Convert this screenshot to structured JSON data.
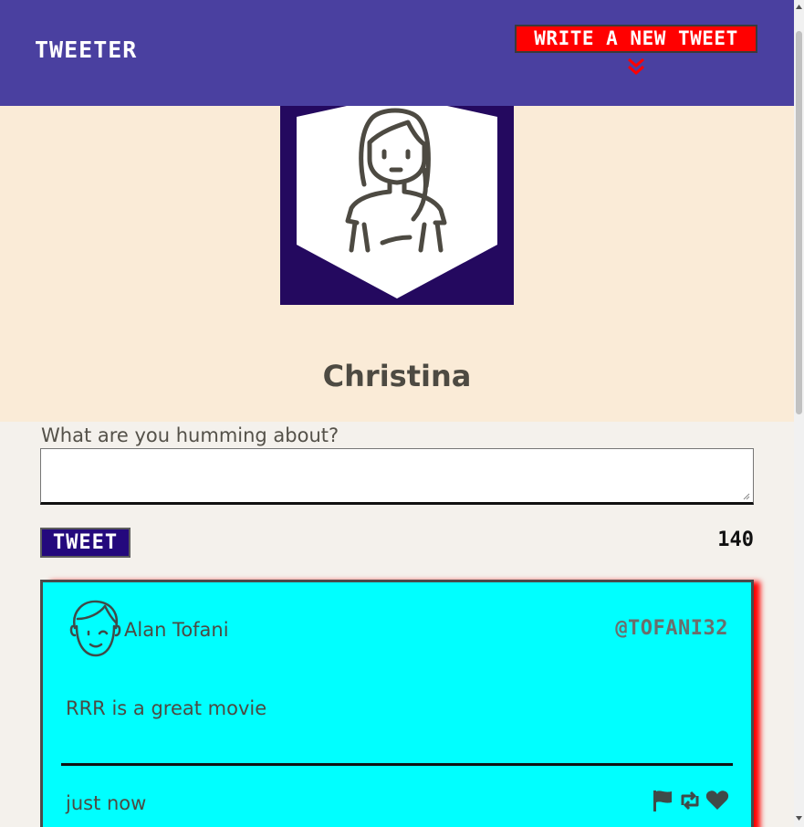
{
  "nav": {
    "brand": "TWEETER",
    "compose_label": "WRITE A NEW TWEET",
    "compose_icon": "double-chevron-down-icon"
  },
  "profile": {
    "name": "Christina",
    "avatar_icon": "woman-avatar-icon"
  },
  "composer": {
    "label": "What are you humming about?",
    "value": "",
    "button_label": "TWEET",
    "counter": "140"
  },
  "tweets": [
    {
      "name": "Alan Tofani",
      "handle": "@TOFANI32",
      "content": "RRR is a great movie",
      "time": "just now",
      "actions": [
        "flag-icon",
        "retweet-icon",
        "heart-icon"
      ]
    }
  ],
  "colors": {
    "nav": "#4a40a0",
    "compose_button": "#ff0000",
    "profile_bg": "#faebd7",
    "avatar_bg": "#24095f",
    "tweet_bg": "#00ffff",
    "tweet_shadow": "#ff0000",
    "tweet_button": "#24097d"
  }
}
